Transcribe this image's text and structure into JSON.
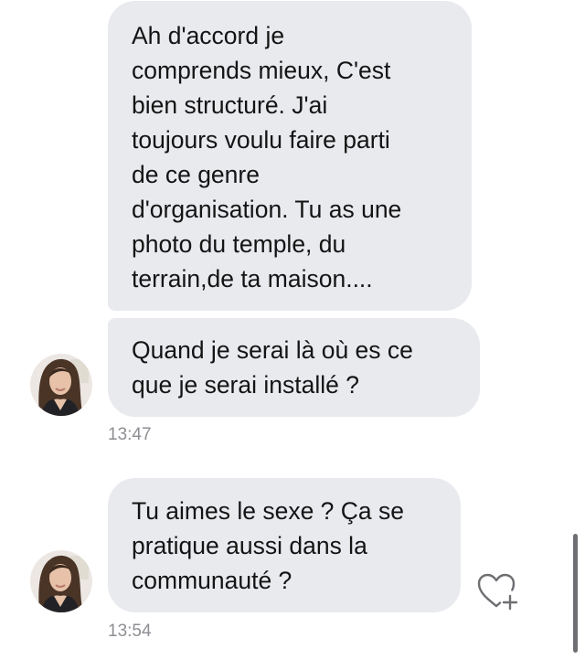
{
  "messages": [
    {
      "text": "Ah d'accord je\ncomprends mieux, C'est\nbien structuré. J'ai\ntoujours voulu faire parti\nde ce genre\nd'organisation. Tu as une\nphoto du temple, du\nterrain,de ta maison...."
    },
    {
      "text": "Quand je serai là où es ce\nque je serai installé ?",
      "timestamp": "13:47"
    },
    {
      "text": "Tu aimes le sexe ? Ça se\npratique aussi dans la\ncommunauté ?",
      "timestamp": "13:54"
    }
  ],
  "icons": {
    "avatar": "contact-avatar-photo",
    "reaction": "heart-plus-icon"
  },
  "colors": {
    "bubble": "#e9eaee",
    "timestamp": "#8e8e93",
    "icon": "#6e6e73"
  }
}
